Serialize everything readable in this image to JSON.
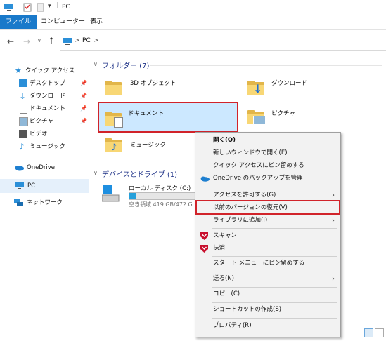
{
  "window": {
    "title": "PC"
  },
  "ribbon": {
    "tabs": [
      "ファイル",
      "コンピューター",
      "表示"
    ]
  },
  "address": {
    "path": [
      "PC"
    ],
    "separator": ">"
  },
  "nav": {
    "quick_access": "クイック アクセス",
    "items": [
      "デスクトップ",
      "ダウンロード",
      "ドキュメント",
      "ピクチャ",
      "ビデオ",
      "ミュージック"
    ],
    "pinned": [
      "📌",
      "📌",
      "📌",
      "📌"
    ],
    "onedrive": "OneDrive",
    "pc": "PC",
    "network": "ネットワーク"
  },
  "content": {
    "folders_header": "フォルダー (7)",
    "folders": [
      "3D オブジェクト",
      "ダウンロード",
      "ドキュメント",
      "ピクチャ",
      "ミュージック"
    ],
    "devices_header": "デバイスとドライブ (1)",
    "drive": {
      "name": "ローカル ディスク (C:)",
      "free": "空き領域 419 GB/472 G"
    }
  },
  "context_menu": {
    "items": [
      {
        "label": "開く(O)",
        "bold": true
      },
      {
        "label": "新しいウィンドウで開く(E)"
      },
      {
        "label": "クイック アクセスにピン留めする"
      },
      {
        "label": "OneDrive のバックアップを管理"
      },
      {
        "label": "アクセスを許可する(G)",
        "submenu": true
      },
      {
        "label": "以前のバージョンの復元(V)",
        "highlight": true
      },
      {
        "label": "ライブラリに追加(I)",
        "submenu": true
      },
      {
        "label": "スキャン"
      },
      {
        "label": "抹消"
      },
      {
        "label": "スタート メニューにピン留めする"
      },
      {
        "label": "送る(N)",
        "submenu": true
      },
      {
        "label": "コピー(C)"
      },
      {
        "label": "ショートカットの作成(S)"
      },
      {
        "label": "プロパティ(R)"
      }
    ],
    "submenu_arrow": "›"
  },
  "colors": {
    "accent": "#1979ca",
    "highlight_box": "#d1232a",
    "selection": "#cce8ff",
    "header": "#1e3287"
  }
}
